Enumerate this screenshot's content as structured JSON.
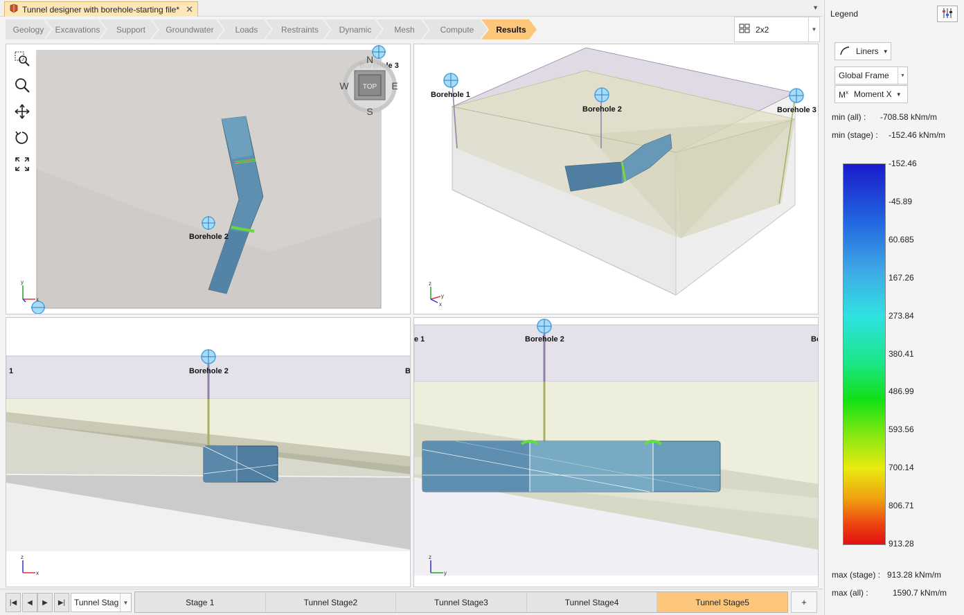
{
  "document": {
    "tab_title": "Tunnel designer with borehole-starting file*"
  },
  "workflow": {
    "steps": [
      "Geology",
      "Excavations",
      "Support",
      "Groundwater",
      "Loads",
      "Restraints",
      "Dynamic",
      "Mesh",
      "Compute",
      "Results"
    ],
    "active": "Results"
  },
  "layout": {
    "value": "2x2"
  },
  "views": {
    "top": {
      "compass": {
        "n": "N",
        "s": "S",
        "e": "E",
        "w": "W",
        "center": "TOP"
      },
      "labels": [
        "Borehole 3",
        "Borehole 2"
      ]
    },
    "perspective": {
      "labels": [
        "Borehole 1",
        "Borehole 2",
        "Borehole 3"
      ]
    },
    "front": {
      "labels": [
        "Borehole 2",
        "1",
        "B"
      ]
    },
    "side": {
      "labels": [
        "Borehole 2",
        "e 1",
        "Bo"
      ]
    },
    "axis": {
      "x": "x",
      "y": "y",
      "z": "z"
    }
  },
  "stages": {
    "selector": "Tunnel Stag",
    "items": [
      "Stage 1",
      "Tunnel Stage2",
      "Tunnel Stage3",
      "Tunnel Stage4",
      "Tunnel Stage5"
    ],
    "active_index": 4,
    "add_label": "+"
  },
  "legend": {
    "title": "Legend",
    "liners_label": "Liners",
    "frame_label": "Global Frame",
    "component_symbol": "M",
    "component_sup": "x",
    "component_label": "Moment X",
    "min_all_label": "min (all) :",
    "min_all_value": "-708.58 kNm/m",
    "min_stage_label": "min (stage) :",
    "min_stage_value": "-152.46 kNm/m",
    "scale": [
      "-152.46",
      "-45.89",
      "60.685",
      "167.26",
      "273.84",
      "380.41",
      "486.99",
      "593.56",
      "700.14",
      "806.71",
      "913.28"
    ],
    "max_stage_label": "max (stage) :",
    "max_stage_value": "913.28 kNm/m",
    "max_all_label": "max (all) :",
    "max_all_value": "1590.7 kNm/m",
    "colors": {
      "low": "#1a1acc",
      "mid": "#12e014",
      "high": "#e01010"
    }
  }
}
